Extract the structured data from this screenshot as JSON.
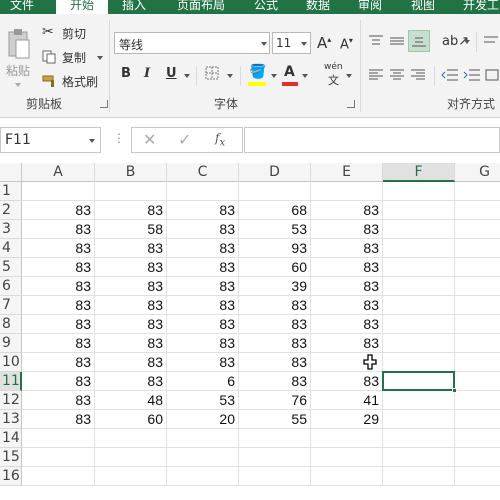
{
  "tabs": [
    {
      "label": "文件",
      "active": false
    },
    {
      "label": "开始",
      "active": true
    },
    {
      "label": "插入",
      "active": false
    },
    {
      "label": "页面布局",
      "active": false
    },
    {
      "label": "公式",
      "active": false
    },
    {
      "label": "数据",
      "active": false
    },
    {
      "label": "审阅",
      "active": false
    },
    {
      "label": "视图",
      "active": false
    },
    {
      "label": "开发工",
      "active": false
    }
  ],
  "ribbon": {
    "clipboard": {
      "paste_label": "粘贴",
      "cut_label": "剪切",
      "copy_label": "复制",
      "format_painter_label": "格式刷",
      "group_label": "剪贴板"
    },
    "font": {
      "font_name": "等线",
      "font_size": "11",
      "bold": "B",
      "italic": "I",
      "underline": "U",
      "font_color_letter": "A",
      "phonetic_label": "wén",
      "group_label": "字体",
      "highlight_color": "#ffff00",
      "font_color": "#e03030"
    },
    "alignment": {
      "group_label": "对齐方式"
    }
  },
  "formula_bar": {
    "name_box": "F11",
    "formula": ""
  },
  "sheet": {
    "columns": [
      "A",
      "B",
      "C",
      "D",
      "E",
      "F",
      "G"
    ],
    "selected_column": "F",
    "selected_row": "11",
    "row_labels": [
      "1",
      "2",
      "3",
      "4",
      "5",
      "6",
      "7",
      "8",
      "9",
      "10",
      "11",
      "12",
      "13",
      "14",
      "15",
      "16"
    ],
    "rows": [
      [
        "",
        "",
        "",
        "",
        ""
      ],
      [
        "83",
        "83",
        "83",
        "68",
        "83"
      ],
      [
        "83",
        "58",
        "83",
        "53",
        "83"
      ],
      [
        "83",
        "83",
        "83",
        "93",
        "83"
      ],
      [
        "83",
        "83",
        "83",
        "60",
        "83"
      ],
      [
        "83",
        "83",
        "83",
        "39",
        "83"
      ],
      [
        "83",
        "83",
        "83",
        "83",
        "83"
      ],
      [
        "83",
        "83",
        "83",
        "83",
        "83"
      ],
      [
        "83",
        "83",
        "83",
        "83",
        "83"
      ],
      [
        "83",
        "83",
        "83",
        "83",
        ""
      ],
      [
        "83",
        "83",
        "6",
        "83",
        "83"
      ],
      [
        "83",
        "48",
        "53",
        "76",
        "41"
      ],
      [
        "83",
        "60",
        "20",
        "55",
        "29"
      ],
      [
        "",
        "",
        "",
        "",
        ""
      ],
      [
        "",
        "",
        "",
        "",
        ""
      ],
      [
        "",
        "",
        "",
        "",
        ""
      ]
    ]
  },
  "colors": {
    "accent": "#217346"
  }
}
